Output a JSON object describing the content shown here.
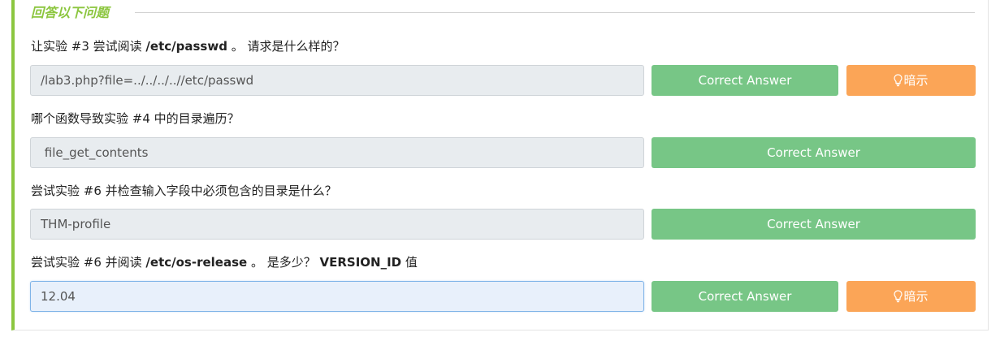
{
  "section": {
    "title": "回答以下问题"
  },
  "questions": [
    {
      "parts": [
        "让实验 #3 尝试阅读 ",
        "/etc/passwd",
        " 。 请求是什么样的？"
      ],
      "answer": "/lab3.php?file=../../../..//etc/passwd",
      "correct_label": "Correct Answer",
      "hint_label": "暗示"
    },
    {
      "text": "哪个函数导致实验 #4 中的目录遍历？",
      "answer": " file_get_contents",
      "correct_label": "Correct Answer"
    },
    {
      "text": "尝试实验 #6 并检查输入字段中必须包含的目录是什么？",
      "answer": "THM-profile",
      "correct_label": "Correct Answer"
    },
    {
      "parts": [
        "尝试实验 #6 并阅读 ",
        "/etc/os-release",
        " 。 是多少？ ",
        "VERSION_ID",
        " 值"
      ],
      "answer": "12.04",
      "correct_label": "Correct Answer",
      "hint_label": "暗示"
    }
  ],
  "colors": {
    "accent": "#8cc63f",
    "correct_button": "#77c686",
    "hint_button": "#fba557",
    "input_bg": "#e8ecef"
  },
  "icons": {
    "hint": "lightbulb-icon"
  }
}
